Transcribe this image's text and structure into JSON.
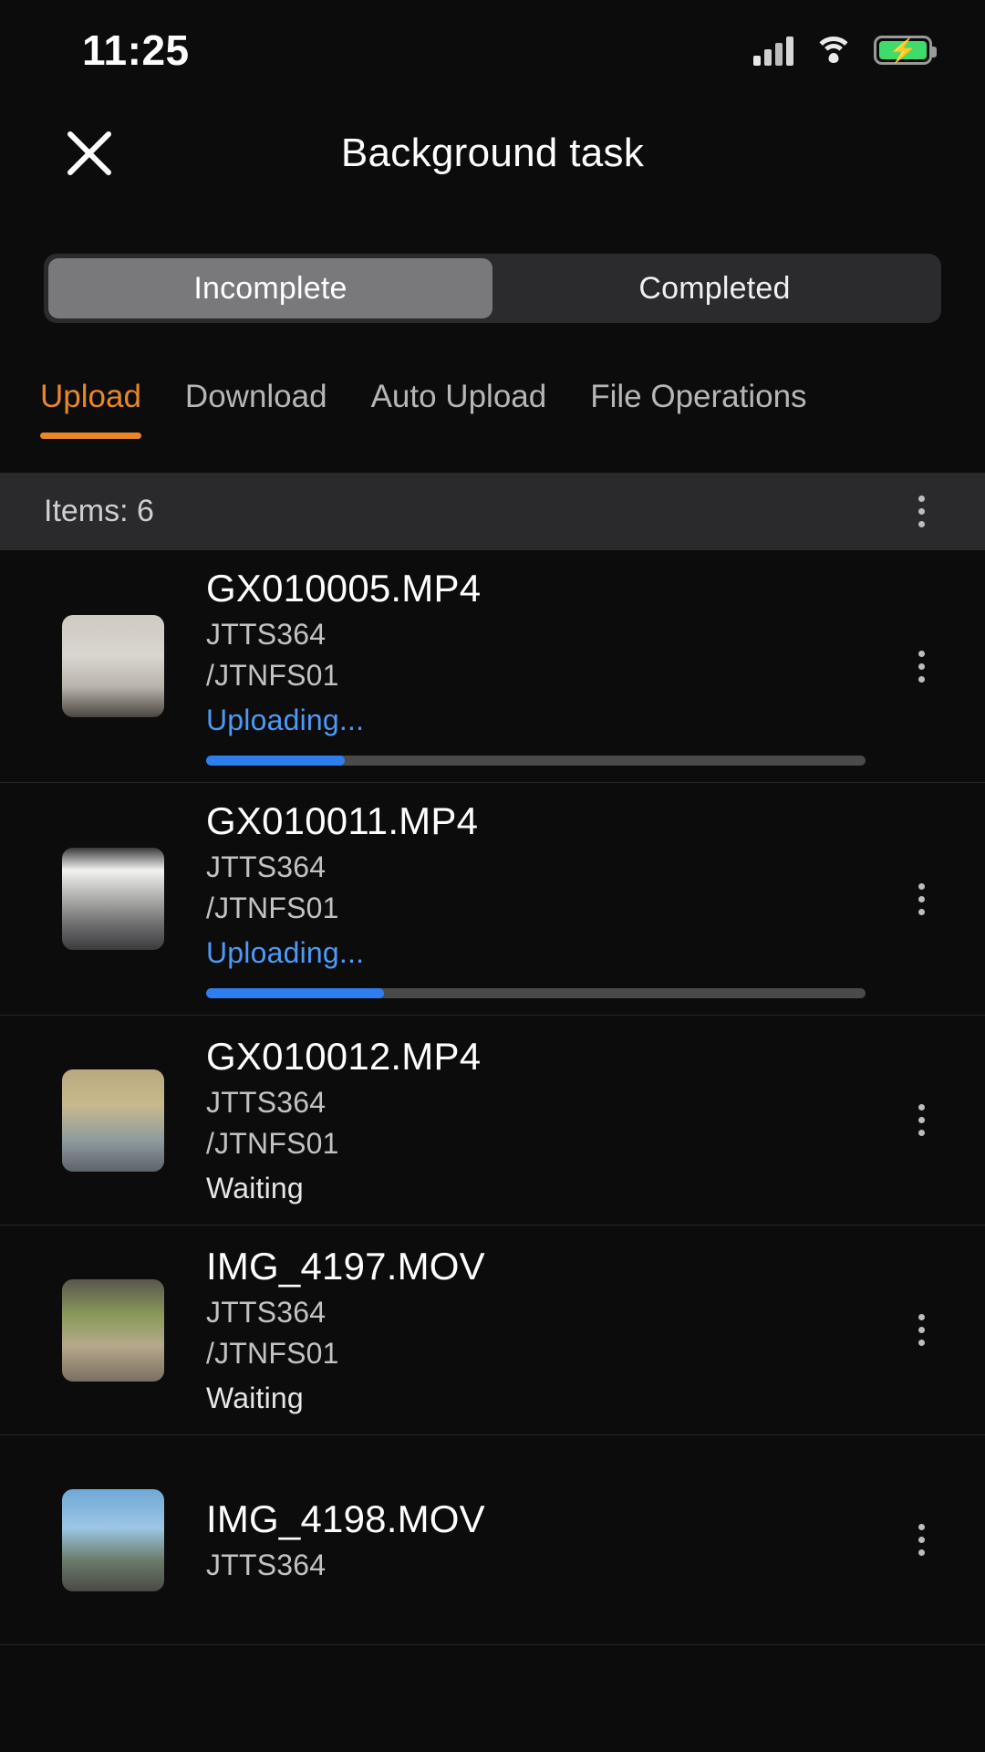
{
  "status_bar": {
    "time": "11:25",
    "signal_icon": "cellular-signal-icon",
    "wifi_icon": "wifi-icon",
    "battery_icon": "battery-charging-icon",
    "battery_color": "#3ddc6b"
  },
  "header": {
    "close_icon": "close-icon",
    "title": "Background task"
  },
  "segmented": {
    "options": [
      {
        "label": "Incomplete",
        "active": true
      },
      {
        "label": "Completed",
        "active": false
      }
    ]
  },
  "tabs": [
    {
      "label": "Upload",
      "active": true
    },
    {
      "label": "Download",
      "active": false
    },
    {
      "label": "Auto Upload",
      "active": false
    },
    {
      "label": "File Operations",
      "active": false
    }
  ],
  "items_bar": {
    "count_label": "Items: 6",
    "menu_icon": "overflow-menu-icon"
  },
  "accent_color": "#e8872a",
  "progress_color": "#2f7ef0",
  "uploading_color": "#4d9af6",
  "list": [
    {
      "filename": "GX010005.MP4",
      "device": "JTTS364",
      "path": "/JTNFS01",
      "status": "Uploading...",
      "state": "uploading",
      "progress": 21,
      "menu_icon": "overflow-menu-icon",
      "thumbnail": "person-white-shirt-indoor"
    },
    {
      "filename": "GX010011.MP4",
      "device": "JTTS364",
      "path": "/JTNFS01",
      "status": "Uploading...",
      "state": "uploading",
      "progress": 27,
      "menu_icon": "overflow-menu-icon",
      "thumbnail": "car-interior-gray"
    },
    {
      "filename": "GX010012.MP4",
      "device": "JTTS364",
      "path": "/JTNFS01",
      "status": "Waiting",
      "state": "waiting",
      "progress": null,
      "menu_icon": "overflow-menu-icon",
      "thumbnail": "person-backpack-tan"
    },
    {
      "filename": "IMG_4197.MOV",
      "device": "JTTS364",
      "path": "/JTNFS01",
      "status": "Waiting",
      "state": "waiting",
      "progress": null,
      "menu_icon": "overflow-menu-icon",
      "thumbnail": "outdoor-green-people"
    },
    {
      "filename": "IMG_4198.MOV",
      "device": "JTTS364",
      "path": "",
      "status": "",
      "state": "waiting",
      "progress": null,
      "menu_icon": "overflow-menu-icon",
      "thumbnail": "blue-sky-buildings"
    }
  ]
}
